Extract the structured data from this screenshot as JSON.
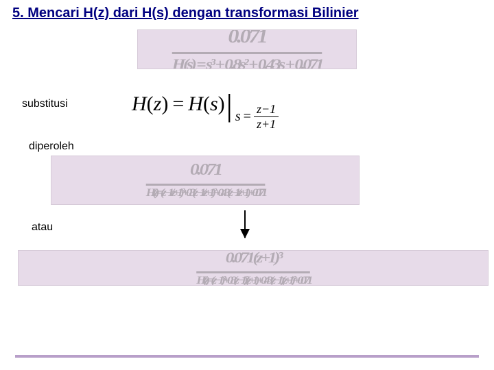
{
  "title": "5. Mencari H(z) dari H(s) dengan transformasi Bilinier",
  "labels": {
    "substitusi": "substitusi",
    "diperoleh": "diperoleh",
    "atau": "atau"
  },
  "substitution": {
    "lhs_fn": "H",
    "lhs_arg": "z",
    "rhs_fn": "H",
    "rhs_arg": "s",
    "sub_var": "s",
    "sub_eq": "=",
    "frac_num": "z−1",
    "frac_den": "z+1"
  },
  "ghost_equations": {
    "eq1_top": "0.071",
    "eq1_bot": "H(s) = s³ + 0.8s² + 0.43s + 0.071",
    "eq2_top": "0.071",
    "eq2_bot": "H(z) = (z−1/z+1)³ + 0.8(z−1/z+1)² + 0.43(z−1/z+1) + 0.071",
    "eq3_top": "0.071(z+1)³",
    "eq3_bot": "H(z) = (z−1)³ + 0.8(z−1)²(z+1) + 0.43(z−1)(z+1)² + 0.071"
  }
}
